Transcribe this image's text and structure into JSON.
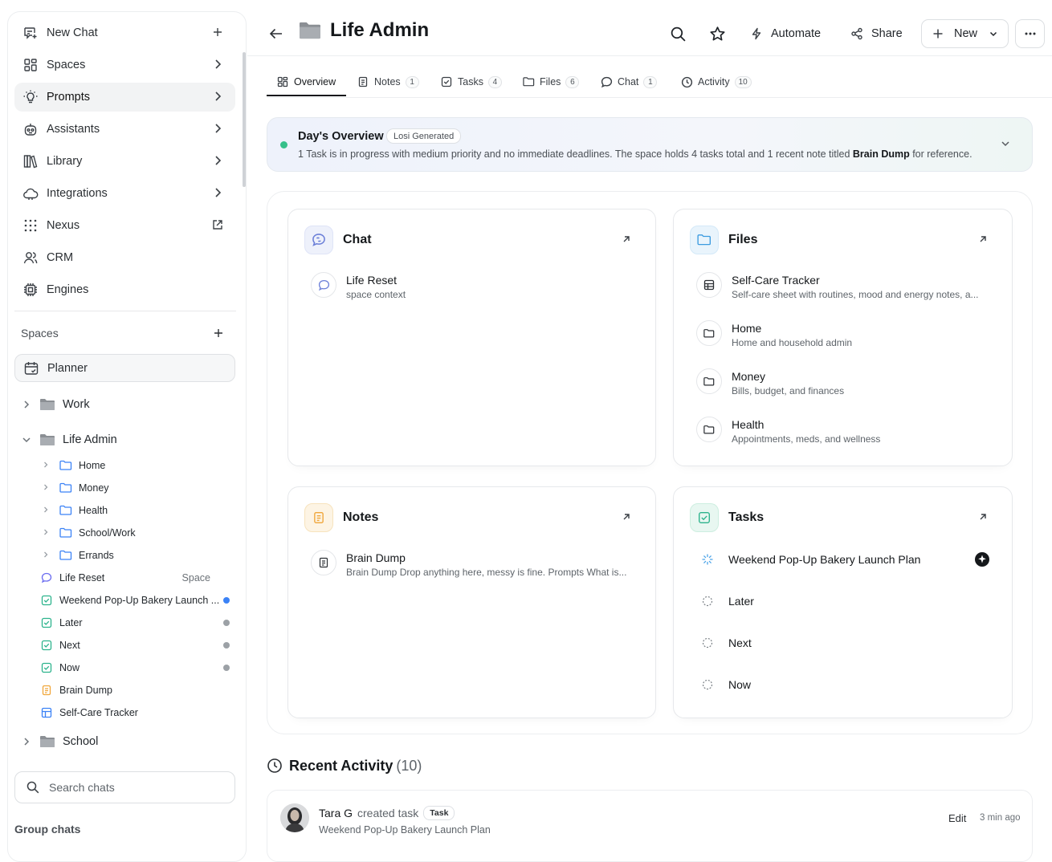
{
  "sidebar": {
    "nav": [
      {
        "label": "New Chat",
        "icon": "new-chat-icon",
        "trail": "plus"
      },
      {
        "label": "Spaces",
        "icon": "spaces-icon",
        "trail": "chevron"
      },
      {
        "label": "Prompts",
        "icon": "lightbulb-icon",
        "trail": "chevron",
        "active": true
      },
      {
        "label": "Assistants",
        "icon": "robot-icon",
        "trail": "chevron"
      },
      {
        "label": "Library",
        "icon": "library-icon",
        "trail": "chevron"
      },
      {
        "label": "Integrations",
        "icon": "cloud-icon",
        "trail": "chevron"
      },
      {
        "label": "Nexus",
        "icon": "grid-dots-icon",
        "trail": "external"
      },
      {
        "label": "CRM",
        "icon": "users-icon",
        "trail": ""
      },
      {
        "label": "Engines",
        "icon": "chip-icon",
        "trail": ""
      }
    ],
    "spaces_heading": "Spaces",
    "planner_label": "Planner",
    "tree": {
      "work": "Work",
      "life_admin": "Life Admin",
      "folders": [
        "Home",
        "Money",
        "Health",
        "School/Work",
        "Errands"
      ],
      "life_reset": "Life Reset",
      "life_reset_tag": "Space",
      "tasks": [
        "Weekend Pop-Up Bakery Launch ...",
        "Later",
        "Next",
        "Now"
      ],
      "brain_dump": "Brain Dump",
      "self_care": "Self-Care Tracker",
      "school": "School"
    },
    "search_placeholder": "Search chats",
    "group_chats": "Group chats"
  },
  "topbar": {
    "title": "Life Admin",
    "automate": "Automate",
    "share": "Share",
    "new": "New"
  },
  "tabs": [
    {
      "label": "Overview",
      "count": null,
      "icon": "overview-icon"
    },
    {
      "label": "Notes",
      "count": "1",
      "icon": "notes-icon"
    },
    {
      "label": "Tasks",
      "count": "4",
      "icon": "tasks-icon"
    },
    {
      "label": "Files",
      "count": "6",
      "icon": "folder-icon"
    },
    {
      "label": "Chat",
      "count": "1",
      "icon": "chat-icon"
    },
    {
      "label": "Activity",
      "count": "10",
      "icon": "clock-icon"
    }
  ],
  "overview": {
    "title": "Day's Overview",
    "tag": "Losi Generated",
    "text_before": "1 Task is in progress with medium priority and no immediate deadlines. The space holds 4 tasks total and 1 recent note titled ",
    "text_bold": "Brain Dump",
    "text_after": " for reference."
  },
  "cards": {
    "chat": {
      "title": "Chat",
      "items": [
        {
          "title": "Life Reset",
          "sub": "space context"
        }
      ]
    },
    "files": {
      "title": "Files",
      "items": [
        {
          "title": "Self-Care Tracker",
          "sub": "Self-care sheet with routines, mood and energy notes, a..."
        },
        {
          "title": "Home",
          "sub": "Home and household admin"
        },
        {
          "title": "Money",
          "sub": "Bills, budget, and finances"
        },
        {
          "title": "Health",
          "sub": "Appointments, meds, and wellness"
        }
      ]
    },
    "notes": {
      "title": "Notes",
      "items": [
        {
          "title": "Brain Dump",
          "sub": "Brain Dump Drop anything here, messy is fine. Prompts What is..."
        }
      ]
    },
    "tasks": {
      "title": "Tasks",
      "items": [
        "Weekend Pop-Up Bakery Launch Plan",
        "Later",
        "Next",
        "Now"
      ]
    }
  },
  "recent_activity": {
    "title": "Recent Activity",
    "count": "(10)",
    "entry": {
      "user": "Tara G",
      "action": "created task",
      "tag": "Task",
      "subject": "Weekend Pop-Up Bakery Launch Plan",
      "edit": "Edit",
      "time": "3 min ago"
    }
  },
  "colors": {
    "accent_blue": "#3b82f6",
    "green": "#36c08a",
    "orange": "#f0a63a",
    "teal": "#2cb38c"
  }
}
